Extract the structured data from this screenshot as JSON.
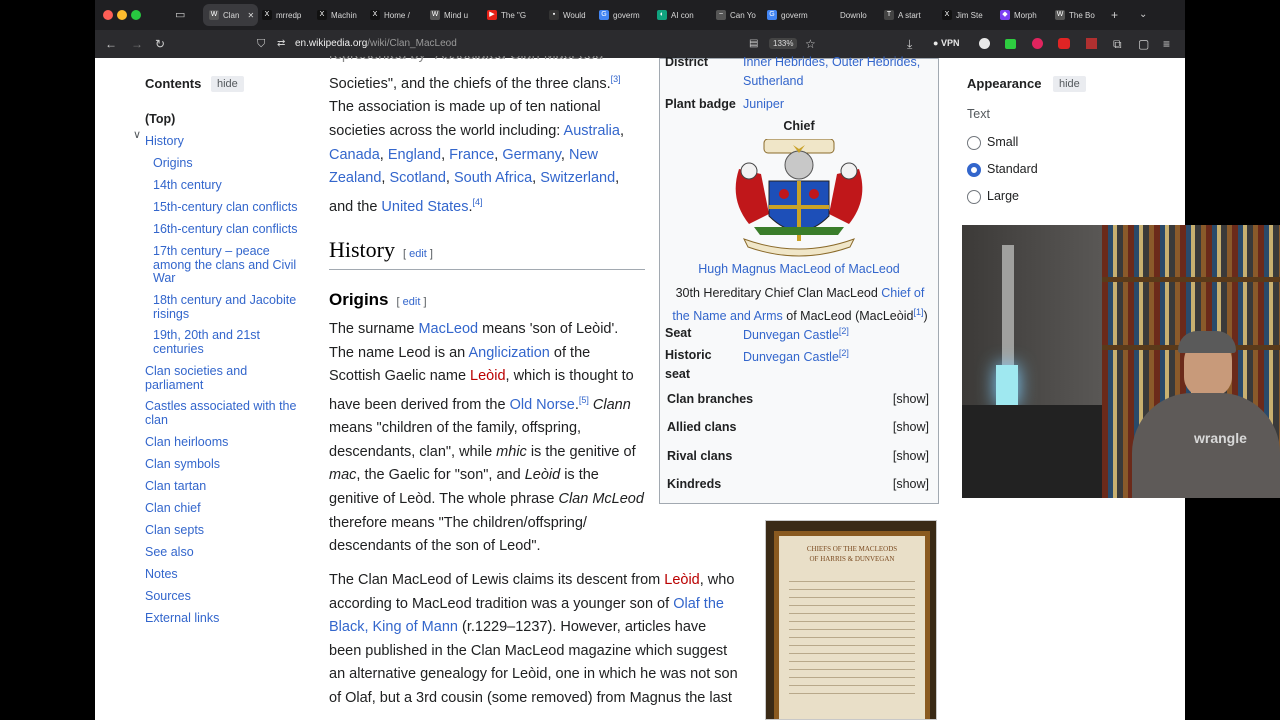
{
  "browser": {
    "tabs": [
      {
        "label": "Clan",
        "favicon": "W"
      },
      {
        "label": "mrredp",
        "favicon": "X"
      },
      {
        "label": "Machin",
        "favicon": "X"
      },
      {
        "label": "Home /",
        "favicon": "X"
      },
      {
        "label": "Mind u",
        "favicon": "W"
      },
      {
        "label": "The \"G",
        "favicon": "▶"
      },
      {
        "label": "Would",
        "favicon": "▪"
      },
      {
        "label": "goverm",
        "favicon": "G"
      },
      {
        "label": "AI con",
        "favicon": "◐"
      },
      {
        "label": "Can Yo",
        "favicon": "~"
      },
      {
        "label": "goverm",
        "favicon": "G"
      },
      {
        "label": "Downlo",
        "favicon": ""
      },
      {
        "label": "A start",
        "favicon": "T"
      },
      {
        "label": "Jim Ste",
        "favicon": "X"
      },
      {
        "label": "Morph",
        "favicon": "◆"
      },
      {
        "label": "The Bo",
        "favicon": "W"
      }
    ],
    "url_domain": "en.wikipedia.org",
    "url_path": "/wiki/Clan_MacLeod",
    "zoom": "133%",
    "vpn_label": "VPN",
    "colors": {
      "tabbar": "#1f1f22",
      "toolbar": "#2b2b2e",
      "link": "#3366cc",
      "red_link": "#ba0000",
      "radio_on": "#3366cc"
    }
  },
  "toc": {
    "title": "Contents",
    "hide_label": "hide",
    "items": [
      "(Top)",
      "History",
      "Origins",
      "14th century",
      "15th-century clan conflicts",
      "16th-century clan conflicts",
      "17th century – peace among the clans and Civil War",
      "18th century and Jacobite risings",
      "19th, 20th and 21st centuries",
      "Clan societies and parliament",
      "Castles associated with the clan",
      "Clan heirlooms",
      "Clan symbols",
      "Clan tartan",
      "Clan chief",
      "Clan septs",
      "See also",
      "Notes",
      "Sources",
      "External links"
    ]
  },
  "article": {
    "top_partial": "represented by \"Associated Clan MacLeod",
    "p1_start": "Societies\", and the chiefs of the three clans.",
    "ref3": "[3]",
    "p1_line2": "The association is made up of ten national",
    "p1_line3": "societies across the world including: ",
    "countries": [
      "Australia",
      "Canada",
      "England",
      "France",
      "Germany",
      "New Zealand",
      "Scotland",
      "South Africa",
      "Switzerland",
      "United States"
    ],
    "and_the": "and the ",
    "ref4": "[4]",
    "history_heading": "History",
    "origins_heading": "Origins",
    "edit_label": "edit",
    "origins_p": {
      "t1": "The surname ",
      "macleod": "MacLeod",
      "t2": " means 'son of Leòid'.",
      "t3": "The name Leod is an ",
      "anglicization": "Anglicization",
      "t4": " of the",
      "t5": "Scottish Gaelic name ",
      "leoid": "Leòid",
      "t6": ", which is thought to",
      "t7": "have been derived from the ",
      "oldnorse": "Old Norse",
      "ref5": "[5]",
      "clann": "Clann",
      "t8": "means \"children of the family, offspring,",
      "t9": "descendants, clan\", while ",
      "mhic": "mhic",
      "t10": " is the genitive of",
      "mac": "mac",
      "t11": ", the Gaelic for \"son\", and ",
      "leoid2": "Leòid",
      "t12": " is the",
      "t13": "genitive of Leòd. The whole phrase ",
      "clanmcleod": "Clan McLeod",
      "t14": "therefore means \"The children/offspring/",
      "t15": "descendants of the son of Leod\"."
    },
    "lewis_p": {
      "t1": "The Clan MacLeod of Lewis claims its descent from ",
      "leoid": "Leòid",
      "t2": ", who",
      "t3": "according to MacLeod tradition was a younger son of ",
      "olaf": "Olaf the",
      "olaf2": "Black, King of Mann",
      "t4": " (r.1229–1237). However, articles have",
      "t5": "been published in the Clan MacLeod magazine which suggest",
      "t6": "an alternative genealogy for Leòid, one in which he was not son",
      "t7": "of Olaf, but a 3rd cousin (some removed) from Magnus the last"
    }
  },
  "infobox": {
    "district_label": "District",
    "district_values": [
      "Inner Hebrides",
      "Outer Hebrides",
      "Sutherland"
    ],
    "plant_label": "Plant badge",
    "plant_value": "Juniper",
    "chief_header": "Chief",
    "chief_name": "Hugh Magnus MacLeod of MacLeod",
    "chief_title_1": "30th Hereditary Chief Clan MacLeod ",
    "chief_title_link1": "Chief of",
    "chief_title_link2": "the Name and Arms",
    "chief_title_2": " of MacLeod (MacLeòid",
    "ref1": "[1]",
    "seat_label": "Seat",
    "seat_value": "Dunvegan Castle",
    "ref2": "[2]",
    "historic_label_1": "Historic",
    "historic_label_2": "seat",
    "historic_value": "Dunvegan Castle",
    "rows": [
      "Clan branches",
      "Allied clans",
      "Rival clans",
      "Kindreds"
    ],
    "show_label": "[show]"
  },
  "appearance": {
    "title": "Appearance",
    "hide_label": "hide",
    "text_label": "Text",
    "options": [
      "Small",
      "Standard",
      "Large"
    ],
    "selected": "Standard"
  },
  "photo": {
    "caption_line1": "CHIEFS OF THE MACLEODS",
    "caption_line2": "OF HARRIS & DUNVEGAN"
  },
  "webcam": {
    "shirt_text": "wrangle"
  }
}
